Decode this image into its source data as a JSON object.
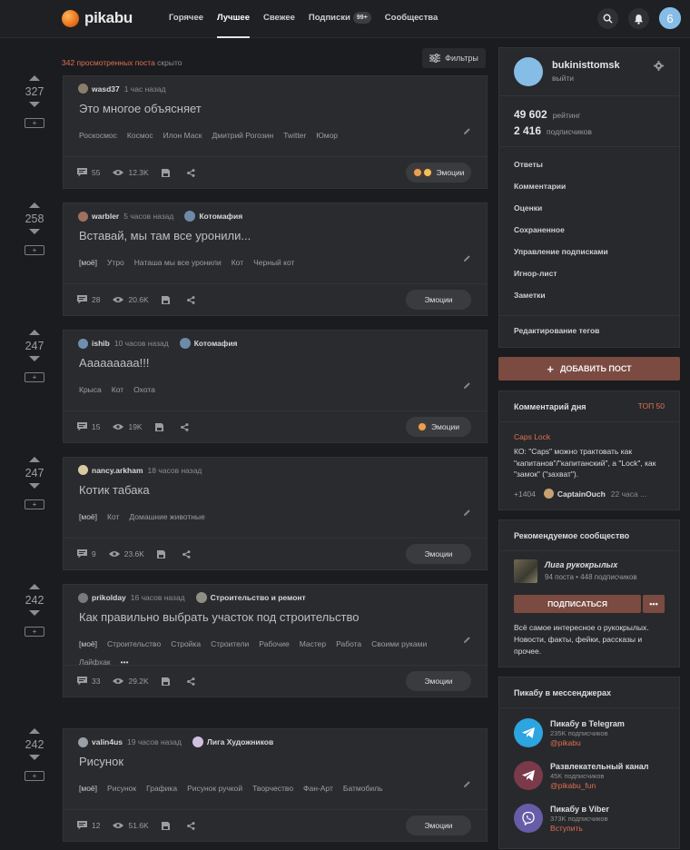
{
  "header": {
    "logo_text": "pikabu",
    "nav": [
      {
        "label": "Горячее",
        "active": false
      },
      {
        "label": "Лучшее",
        "active": true
      },
      {
        "label": "Свежее",
        "active": false
      },
      {
        "label": "Подписки",
        "active": false,
        "badge": "99+"
      },
      {
        "label": "Сообщества",
        "active": false
      }
    ],
    "avatar_text": "6"
  },
  "feed": {
    "hidden_count": "342 просмотренных поста",
    "hidden_suffix": "скрыто",
    "filters_label": "Фильтры"
  },
  "posts": [
    {
      "rating": "327",
      "author": "wasd37",
      "time": "1 час назад",
      "community": "",
      "title": "Это многое объясняет",
      "tags": [
        "Роскосмос",
        "Космос",
        "Илон Маск",
        "Дмитрий Рогозин",
        "Twitter",
        "Юмор"
      ],
      "comments": "55",
      "views": "12.3K",
      "emotions_label": "Эмоции",
      "has_emotions": true
    },
    {
      "rating": "258",
      "author": "warbler",
      "time": "5 часов назад",
      "community": "Котомафия",
      "title": "Вставай, мы там все уронили...",
      "tags": [
        "[моё]",
        "Утро",
        "Наташа мы все уронили",
        "Кот",
        "Черный кот"
      ],
      "comments": "28",
      "views": "20.6K",
      "emotions_label": "Эмоции",
      "has_emotions": false
    },
    {
      "rating": "247",
      "author": "ishib",
      "time": "10 часов назад",
      "community": "Котомафия",
      "title": "Ааааааааа!!!",
      "tags": [
        "Крыса",
        "Кот",
        "Охота"
      ],
      "comments": "15",
      "views": "19K",
      "emotions_label": "Эмоции",
      "has_emotions": true
    },
    {
      "rating": "247",
      "author": "nancy.arkham",
      "time": "18 часов назад",
      "community": "",
      "title": "Котик табака",
      "tags": [
        "[моё]",
        "Кот",
        "Домашние животные"
      ],
      "comments": "9",
      "views": "23.6K",
      "emotions_label": "Эмоции",
      "has_emotions": false
    },
    {
      "rating": "242",
      "author": "prikolday",
      "time": "16 часов назад",
      "community": "Строительство и ремонт",
      "title": "Как правильно выбрать участок под строительство",
      "tags": [
        "[моё]",
        "Строительство",
        "Стройка",
        "Строители",
        "Рабочие",
        "Мастер",
        "Работа",
        "Своими руками",
        "Лайфхак",
        "•••"
      ],
      "comments": "33",
      "views": "29.2K",
      "emotions_label": "Эмоции",
      "has_emotions": false
    },
    {
      "rating": "242",
      "author": "valin4us",
      "time": "19 часов назад",
      "community": "Лига Художников",
      "title": "Рисунок",
      "tags": [
        "[моё]",
        "Рисунок",
        "Графика",
        "Рисунок ручкой",
        "Творчество",
        "Фан-Арт",
        "Батмобиль"
      ],
      "comments": "12",
      "views": "51.6K",
      "emotions_label": "Эмоции",
      "has_emotions": false
    }
  ],
  "profile": {
    "username": "bukinisttomsk",
    "logout": "выйти",
    "rating_value": "49 602",
    "rating_label": "рейтинг",
    "subs_value": "2 416",
    "subs_label": "подписчиков",
    "menu": [
      "Ответы",
      "Комментарии",
      "Оценки",
      "Сохраненное",
      "Управление подписками",
      "Игнор-лист",
      "Заметки"
    ],
    "edit_tags": "Редактирование тегов"
  },
  "add_post_label": "ДОБАВИТЬ ПОСТ",
  "comment_of_day": {
    "title": "Комментарий дня",
    "top_link": "ТОП 50",
    "post_link": "Caps Lock",
    "text": "КО: \"Caps\" можно трактовать как \"капитанов\"/\"капитанский\", а \"Lock\", как \"замок\" (\"захват\").",
    "rating": "+1404",
    "author": "CaptainOuch",
    "time": "22 часа ..."
  },
  "recommended": {
    "title": "Рекомендуемое сообщество",
    "name": "Лига рукокрылых",
    "stats": "94 поста • 448 подписчиков",
    "subscribe_label": "ПОДПИСАТЬСЯ",
    "more_label": "•••",
    "description": "Всё самое интересное о рукокрылых. Новости, факты, фейки, рассказы и прочее."
  },
  "messengers": {
    "title": "Пикабу в мессенджерах",
    "items": [
      {
        "name": "Пикабу в Telegram",
        "subs": "235K подписчиков",
        "link": "@pikabu",
        "color": "#2ca5e0"
      },
      {
        "name": "Развлекательный канал",
        "subs": "45K подписчиков",
        "link": "@pikabu_fun",
        "color": "#7b3a4a"
      },
      {
        "name": "Пикабу в Viber",
        "subs": "373K подписчиков",
        "link": "Вступить",
        "color": "#665ca7"
      }
    ]
  }
}
